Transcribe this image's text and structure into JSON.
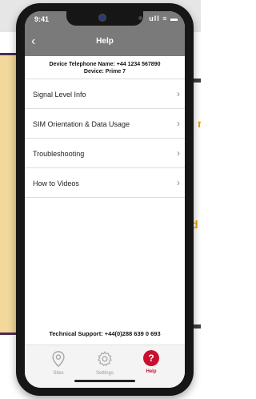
{
  "status_bar": {
    "time": "9:41",
    "icons": "ull ≡ ▬"
  },
  "header": {
    "title": "Help",
    "back_icon": "chevron-left-icon"
  },
  "device": {
    "name_line": "Device Telephone Name: +44 1234 567890",
    "device_line": "Device: Prime 7"
  },
  "menu": {
    "items": [
      {
        "label": "Signal Level Info"
      },
      {
        "label": "SIM Orientation & Data Usage"
      },
      {
        "label": "Troubleshooting"
      },
      {
        "label": "How to Videos"
      }
    ]
  },
  "support": {
    "text": "Technical Support: +44(0)288 639 0 693"
  },
  "tabs": [
    {
      "label": "Sites",
      "icon": "location-pin-icon"
    },
    {
      "label": "Settings",
      "icon": "gear-icon"
    },
    {
      "label": "Help",
      "icon": "question-icon"
    }
  ],
  "peek": {
    "letter_a": "r",
    "letter_b": "d"
  },
  "colors": {
    "accent": "#c8102e",
    "nav": "#7a7a7a"
  }
}
